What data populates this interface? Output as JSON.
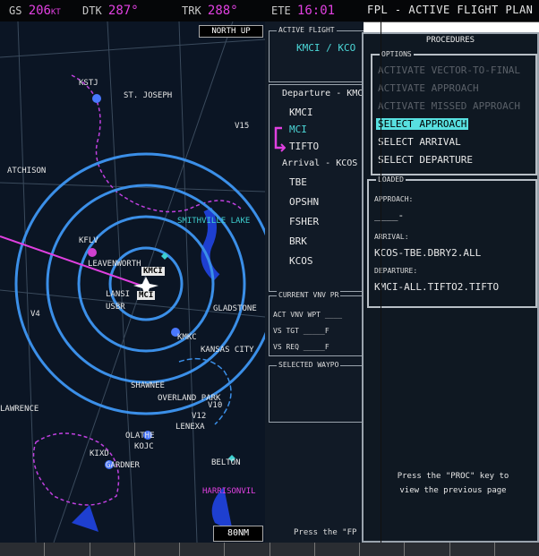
{
  "status_bar": {
    "gs": {
      "label": "GS",
      "value": "206",
      "unit": "KT"
    },
    "dtk": {
      "label": "DTK",
      "value": "287°"
    },
    "trk": {
      "label": "TRK",
      "value": "288°"
    },
    "ete": {
      "label": "ETE",
      "value": "16:01"
    },
    "page_title": "FPL - ACTIVE FLIGHT PLAN"
  },
  "map": {
    "orientation": "NORTH UP",
    "range": "80NM",
    "labels": {
      "ksti": "KSTJ",
      "st_joseph": "ST. JOSEPH",
      "atchison": "ATCHISON",
      "kflv": "KFLV",
      "leavenworth": "LEAVENWORTH",
      "kmci": "KMCI",
      "mci": "MCI",
      "lansing": "LANSI",
      "usbr": "USBR",
      "gladstone": "GLADSTONE",
      "kmkc": "KMKC",
      "kansas_city": "KANSAS CITY",
      "shawnee": "SHAWNEE",
      "overland_park": "OVERLAND PARK",
      "lenexa": "LENEXA",
      "olathe": "OLATHE",
      "kojc": "KOJC",
      "kixd": "KIXD",
      "gardner": "GARDNER",
      "belton": "BELTON",
      "harrisonville": "HARRISONVIL",
      "smithville": "SMITHVILLE LAKE",
      "lawrence": "LAWRENCE",
      "v1": "V15",
      "v2": "V12",
      "v3": "V10",
      "v4": "V4"
    }
  },
  "flight_plan": {
    "active_title": "ACTIVE FLIGHT",
    "route": "KMCI / KCO",
    "departure_header": "Departure - KMC",
    "departure_wpts": [
      "KMCI",
      "MCI",
      "TIFTO"
    ],
    "arrival_header": "Arrival - KCOS",
    "arrival_wpts": [
      "TBE",
      "OPSHN",
      "FSHER",
      "BRK",
      "KCOS"
    ],
    "vnv_title": "CURRENT VNV PR",
    "vnv_rows": [
      {
        "label": "ACT VNV WPT",
        "value": "____"
      },
      {
        "label": "VS TGT",
        "value": "_____F"
      },
      {
        "label": "VS REQ",
        "value": "_____F"
      }
    ],
    "selected_title": "SELECTED WAYPO",
    "bottom_note": "Press the \"FP"
  },
  "procedures": {
    "title": "PROCEDURES",
    "options_title": "OPTIONS",
    "options": [
      {
        "label": "ACTIVATE VECTOR-TO-FINAL",
        "state": "disabled"
      },
      {
        "label": "ACTIVATE APPROACH",
        "state": "disabled"
      },
      {
        "label": "ACTIVATE MISSED APPROACH",
        "state": "disabled"
      },
      {
        "label": "SELECT APPROACH",
        "state": "selected"
      },
      {
        "label": "SELECT ARRIVAL",
        "state": "enabled"
      },
      {
        "label": "SELECT DEPARTURE",
        "state": "enabled"
      }
    ],
    "loaded_title": "LOADED",
    "approach_label": "APPROACH:",
    "approach_value": "____-",
    "arrival_label": "ARRIVAL:",
    "arrival_value": "KCOS-TBE.DBRY2.ALL",
    "departure_label": "DEPARTURE:",
    "departure_value": "KMCI-ALL.TIFTO2.TIFTO",
    "note_line1": "Press the \"PROC\" key to",
    "note_line2": "view the previous page"
  },
  "colors": {
    "magenta": "#e040e0",
    "cyan": "#4cd7d8",
    "map_bg": "#0b1524",
    "range_ring": "#3b8fe8"
  }
}
